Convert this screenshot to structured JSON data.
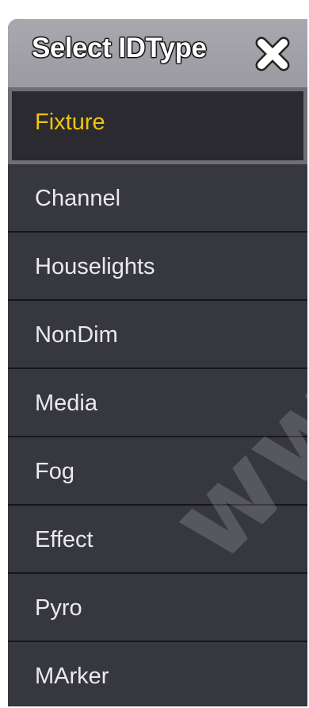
{
  "dialog": {
    "title": "Select IDType",
    "close_icon": "close-icon"
  },
  "items": [
    {
      "label": "Fixture",
      "selected": true
    },
    {
      "label": "Channel",
      "selected": false
    },
    {
      "label": "Houselights",
      "selected": false
    },
    {
      "label": "NonDim",
      "selected": false
    },
    {
      "label": "Media",
      "selected": false
    },
    {
      "label": "Fog",
      "selected": false
    },
    {
      "label": "Effect",
      "selected": false
    },
    {
      "label": "Pyro",
      "selected": false
    },
    {
      "label": "MArker",
      "selected": false
    }
  ],
  "colors": {
    "selected_text": "#f1c40f",
    "item_text": "#e9e9ee",
    "item_bg": "#373740",
    "title_bar": "#a0a0a6"
  },
  "watermark": "www.carl"
}
